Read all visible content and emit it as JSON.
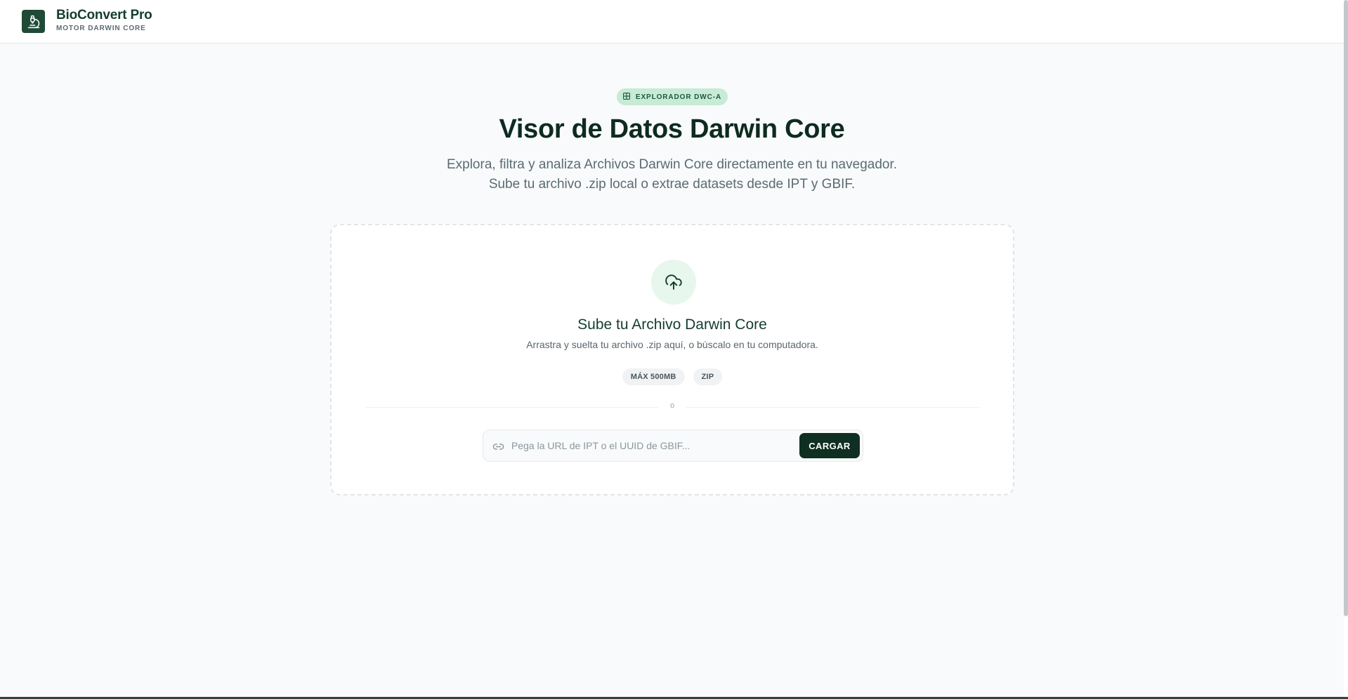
{
  "header": {
    "brand_title": "BioConvert Pro",
    "brand_subtitle": "MOTOR DARWIN CORE",
    "logo_icon": "microscope-icon"
  },
  "hero": {
    "badge": "EXPLORADOR DWC-A",
    "badge_icon": "grid-icon",
    "title": "Visor de Datos Darwin Core",
    "description_line1": "Explora, filtra y analiza Archivos Darwin Core directamente en tu navegador.",
    "description_line2": "Sube tu archivo .zip local o extrae datasets desde IPT y GBIF."
  },
  "upload": {
    "icon": "cloud-upload-icon",
    "title": "Sube tu Archivo Darwin Core",
    "description": "Arrastra y suelta tu archivo .zip aquí, o búscalo en tu computadora.",
    "tags": [
      "MÁX 500MB",
      "ZIP"
    ],
    "divider_text": "o",
    "url_placeholder": "Pega la URL de IPT o el UUID de GBIF...",
    "url_value": "",
    "load_button": "CARGAR"
  },
  "colors": {
    "brand_dark": "#0f2f22",
    "brand_green": "#1f4a36",
    "badge_bg": "#c7ebd6",
    "upload_circle_bg": "#e7f7ee"
  }
}
